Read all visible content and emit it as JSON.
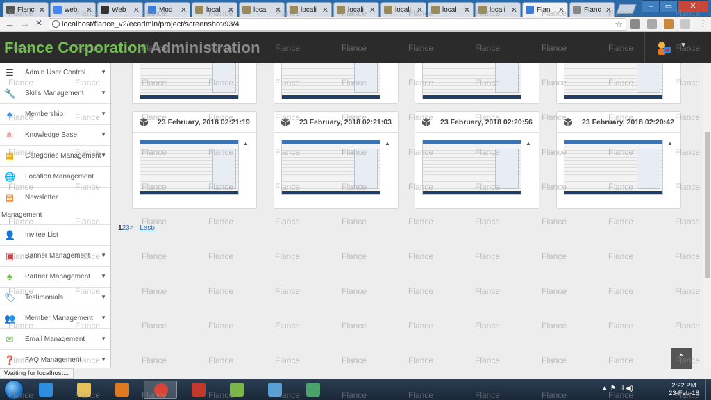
{
  "browser": {
    "tabs": [
      {
        "title": "Flanc",
        "favicon": "#555555",
        "active": false
      },
      {
        "title": "web:",
        "favicon": "#4285f4",
        "active": false
      },
      {
        "title": "Web",
        "favicon": "#333333",
        "active": false
      },
      {
        "title": "Mod",
        "favicon": "#3b7dd8",
        "active": false
      },
      {
        "title": "local",
        "favicon": "#9a8a5a",
        "active": false
      },
      {
        "title": "local",
        "favicon": "#9a8a5a",
        "active": false
      },
      {
        "title": "locali",
        "favicon": "#9a8a5a",
        "active": false
      },
      {
        "title": "locali",
        "favicon": "#9a8a5a",
        "active": false
      },
      {
        "title": "locali",
        "favicon": "#9a8a5a",
        "active": false
      },
      {
        "title": "local",
        "favicon": "#9a8a5a",
        "active": false
      },
      {
        "title": "locali",
        "favicon": "#9a8a5a",
        "active": false
      },
      {
        "title": "Flan",
        "favicon": "#3b7dd8",
        "active": true
      },
      {
        "title": "Flanc",
        "favicon": "#888888",
        "active": false
      }
    ],
    "close_glyph": "✕",
    "window_min": "–",
    "window_max": "▭",
    "window_close": "✕",
    "back_glyph": "←",
    "reload_glyph": "✕",
    "info_glyph": "i",
    "url": "localhost/flance_v2/ecadmin/project/screenshot/93/4",
    "star_glyph": "☆",
    "menu_glyph": "⋮",
    "extension_colors": [
      "#8a8a8a",
      "#a9a9a9",
      "#c9893a",
      "#c8c8c8"
    ]
  },
  "header": {
    "brand_primary": "Flance Corporation",
    "brand_secondary": "Administration",
    "brand_color": "#6fc24a",
    "caret": "▼"
  },
  "sidebar": {
    "items": [
      {
        "label": "Admin User Control",
        "icon": "menu-icon",
        "glyph": "☰",
        "color": "#444444",
        "caret": true
      },
      {
        "label": "Skills Management",
        "icon": "wrench-icon",
        "glyph": "🔧",
        "color": "#6fc24a",
        "caret": true
      },
      {
        "label": "Membership",
        "icon": "users-icon",
        "glyph": "♣",
        "color": "#2e86de",
        "caret": true
      },
      {
        "label": "Knowledge Base",
        "icon": "atom-icon",
        "glyph": "⚛",
        "color": "#d0302f",
        "caret": true
      },
      {
        "label": "Categories Management",
        "icon": "grid-icon",
        "glyph": "▦",
        "color": "#e0a000",
        "caret": true
      },
      {
        "label": "Location Management",
        "icon": "globe-icon",
        "glyph": "🌐",
        "color": "#444444",
        "caret": false
      },
      {
        "label": "Newsletter",
        "icon": "newsletter-icon",
        "glyph": "▤",
        "color": "#e07a20",
        "caret": false
      },
      {
        "label": "Invitee List",
        "icon": "user-icon",
        "glyph": "👤",
        "color": "#d0302f",
        "caret": false
      },
      {
        "label": "Banner Management",
        "icon": "image-icon",
        "glyph": "▣",
        "color": "#d0302f",
        "caret": true
      },
      {
        "label": "Partner Management",
        "icon": "partner-icon",
        "glyph": "♣",
        "color": "#6fc24a",
        "caret": true
      },
      {
        "label": "Testimonials",
        "icon": "tag-icon",
        "glyph": "🏷",
        "color": "#2e86de",
        "caret": true
      },
      {
        "label": "Member Management",
        "icon": "member-icon",
        "glyph": "👥",
        "color": "#e0a000",
        "caret": true
      },
      {
        "label": "Email Management",
        "icon": "envelope-icon",
        "glyph": "✉",
        "color": "#6fc24a",
        "caret": true
      },
      {
        "label": "FAQ Management",
        "icon": "faq-icon",
        "glyph": "❓",
        "color": "#2e86de",
        "caret": true
      }
    ],
    "wrapped_text": "Management",
    "caret_glyph": "▼"
  },
  "screenshots": {
    "cards": [
      {
        "date": "23 February, 2018 02:21:19"
      },
      {
        "date": "23 February, 2018 02:21:03"
      },
      {
        "date": "23 February, 2018 02:20:56"
      },
      {
        "date": "23 February, 2018 02:20:42"
      }
    ],
    "collapse_glyph": "▲"
  },
  "pagination": {
    "pages": [
      "1",
      "2",
      "3"
    ],
    "next": ">",
    "last": "Last›"
  },
  "scroll_top_glyph": "⌃",
  "status": "Waiting for localhost...",
  "taskbar": {
    "apps": [
      {
        "icon": "ie-icon",
        "color": "#2d8ee0",
        "active": false
      },
      {
        "icon": "explorer-icon",
        "color": "#e6c15a",
        "active": false
      },
      {
        "icon": "media-player-icon",
        "color": "#e07a20",
        "active": false
      },
      {
        "icon": "chrome-icon",
        "color": "#db4437",
        "active": true
      },
      {
        "icon": "filezilla-icon",
        "color": "#c0392b",
        "active": false
      },
      {
        "icon": "notepad-icon",
        "color": "#7ab648",
        "active": false
      },
      {
        "icon": "network-icon",
        "color": "#5aa0d6",
        "active": false
      },
      {
        "icon": "snipping-tool-icon",
        "color": "#4aa36b",
        "active": false
      }
    ],
    "tray": "▲ ⚑ .ıl ◀)",
    "time": "2:22 PM",
    "date": "23-Feb-18"
  },
  "watermark": "Flance"
}
